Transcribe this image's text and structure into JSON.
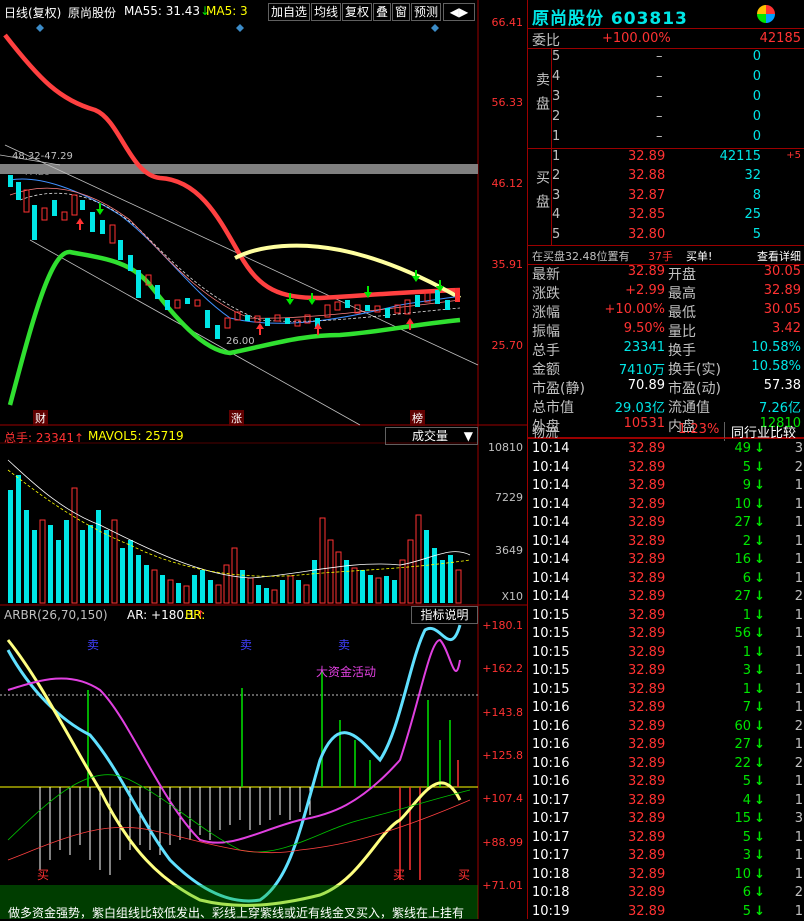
{
  "toolbar": {
    "period_label": "日线(复权)",
    "stock_name": "原尚股份",
    "ma55_label": "MA55: 31.43",
    "ma5_label": "MA5: 3",
    "buttons": [
      "加自选",
      "均线",
      "复权",
      "叠",
      "窗",
      "预测"
    ]
  },
  "price_axis": [
    "66.41",
    "56.33",
    "46.12",
    "35.91",
    "25.70"
  ],
  "chart_annotations": {
    "range_label": "48.32-47.29",
    "high_label": "47.29",
    "low_label": "26.00",
    "bottom_markers": [
      "财",
      "涨",
      "榜"
    ]
  },
  "volume_panel": {
    "total_label": "总手: 23341",
    "mavol_label": "MAVOL5: 25719",
    "dropdown": "成交量",
    "axis": [
      "10810",
      "7229",
      "3649",
      "X10"
    ]
  },
  "arbr_panel": {
    "title": "ARBR(26,70,150)",
    "ar_label": "AR: +180.1",
    "br_label": "BR:",
    "button": "指标说明",
    "annotation": "大资金活动",
    "sell_markers": [
      "卖",
      "卖",
      "卖"
    ],
    "buy_markers": [
      "买",
      "买",
      "买"
    ],
    "axis": [
      "+180.1",
      "+162.2",
      "+143.8",
      "+125.8",
      "+107.4",
      "+88.99",
      "+71.01"
    ],
    "footer": "做多资金强势，紫白组线比较低发出、彩线上穿紫线或近有线金叉买入，紫线在上挂有"
  },
  "quote": {
    "title": "原尚股份  603813",
    "weibi_label": "委比",
    "weibi_pct": "+100.00%",
    "weibi_val": "42185",
    "sell_label": "卖盘",
    "buy_label": "买盘",
    "sell": [
      {
        "lv": "5",
        "price": "–",
        "vol": "0"
      },
      {
        "lv": "4",
        "price": "–",
        "vol": "0"
      },
      {
        "lv": "3",
        "price": "–",
        "vol": "0"
      },
      {
        "lv": "2",
        "price": "–",
        "vol": "0"
      },
      {
        "lv": "1",
        "price": "–",
        "vol": "0"
      }
    ],
    "buy": [
      {
        "lv": "1",
        "price": "32.89",
        "vol": "42115",
        "chg": "+5"
      },
      {
        "lv": "2",
        "price": "32.88",
        "vol": "32",
        "chg": ""
      },
      {
        "lv": "3",
        "price": "32.87",
        "vol": "8",
        "chg": ""
      },
      {
        "lv": "4",
        "price": "32.85",
        "vol": "25",
        "chg": ""
      },
      {
        "lv": "5",
        "price": "32.80",
        "vol": "5",
        "chg": ""
      }
    ],
    "queue": {
      "text": "在买盘32.48位置有",
      "count": "37手",
      "buy": "买单!",
      "detail": "查看详细"
    },
    "stats": [
      {
        "l1": "最新",
        "v1": "32.89",
        "l2": "开盘",
        "v2": "30.05"
      },
      {
        "l1": "涨跌",
        "v1": "+2.99",
        "l2": "最高",
        "v2": "32.89"
      },
      {
        "l1": "涨幅",
        "v1": "+10.00%",
        "l2": "最低",
        "v2": "30.05"
      },
      {
        "l1": "振幅",
        "v1": "9.50%",
        "l2": "量比",
        "v2": "3.42"
      },
      {
        "l1": "总手",
        "v1": "23341",
        "l2": "换手",
        "v2": "10.58%"
      },
      {
        "l1": "金额",
        "v1": "7410万",
        "l2": "换手(实)",
        "v2": "10.58%"
      },
      {
        "l1": "市盈(静)",
        "v1": "70.89",
        "l2": "市盈(动)",
        "v2": "57.38"
      },
      {
        "l1": "总市值",
        "v1": "29.03亿",
        "l2": "流通值",
        "v2": "7.26亿"
      },
      {
        "l1": "外盘",
        "v1": "10531",
        "l2": "内盘",
        "v2": "12810"
      }
    ],
    "wuliu": {
      "label": "物流",
      "pct": "1.23%",
      "btn": "同行业比较"
    }
  },
  "ticks": [
    {
      "t": "10:14",
      "p": "32.89",
      "v": "49",
      "d": "3"
    },
    {
      "t": "10:14",
      "p": "32.89",
      "v": "5",
      "d": "2"
    },
    {
      "t": "10:14",
      "p": "32.89",
      "v": "9",
      "d": "1"
    },
    {
      "t": "10:14",
      "p": "32.89",
      "v": "10",
      "d": "1"
    },
    {
      "t": "10:14",
      "p": "32.89",
      "v": "27",
      "d": "1"
    },
    {
      "t": "10:14",
      "p": "32.89",
      "v": "2",
      "d": "1"
    },
    {
      "t": "10:14",
      "p": "32.89",
      "v": "16",
      "d": "1"
    },
    {
      "t": "10:14",
      "p": "32.89",
      "v": "6",
      "d": "1"
    },
    {
      "t": "10:14",
      "p": "32.89",
      "v": "27",
      "d": "2"
    },
    {
      "t": "10:15",
      "p": "32.89",
      "v": "1",
      "d": "1"
    },
    {
      "t": "10:15",
      "p": "32.89",
      "v": "56",
      "d": "1"
    },
    {
      "t": "10:15",
      "p": "32.89",
      "v": "1",
      "d": "1"
    },
    {
      "t": "10:15",
      "p": "32.89",
      "v": "3",
      "d": "1"
    },
    {
      "t": "10:15",
      "p": "32.89",
      "v": "1",
      "d": "1"
    },
    {
      "t": "10:16",
      "p": "32.89",
      "v": "7",
      "d": "1"
    },
    {
      "t": "10:16",
      "p": "32.89",
      "v": "60",
      "d": "2"
    },
    {
      "t": "10:16",
      "p": "32.89",
      "v": "27",
      "d": "1"
    },
    {
      "t": "10:16",
      "p": "32.89",
      "v": "22",
      "d": "2"
    },
    {
      "t": "10:16",
      "p": "32.89",
      "v": "5",
      "d": "1"
    },
    {
      "t": "10:17",
      "p": "32.89",
      "v": "4",
      "d": "1"
    },
    {
      "t": "10:17",
      "p": "32.89",
      "v": "15",
      "d": "3"
    },
    {
      "t": "10:17",
      "p": "32.89",
      "v": "5",
      "d": "1"
    },
    {
      "t": "10:17",
      "p": "32.89",
      "v": "3",
      "d": "1"
    },
    {
      "t": "10:18",
      "p": "32.89",
      "v": "10",
      "d": "1"
    },
    {
      "t": "10:18",
      "p": "32.89",
      "v": "6",
      "d": "2"
    },
    {
      "t": "10:19",
      "p": "32.89",
      "v": "5",
      "d": "1"
    }
  ],
  "colors": {
    "up": "#ff3232",
    "down": "#00e600",
    "cyan": "#00e6e6",
    "border": "#9b0000"
  }
}
